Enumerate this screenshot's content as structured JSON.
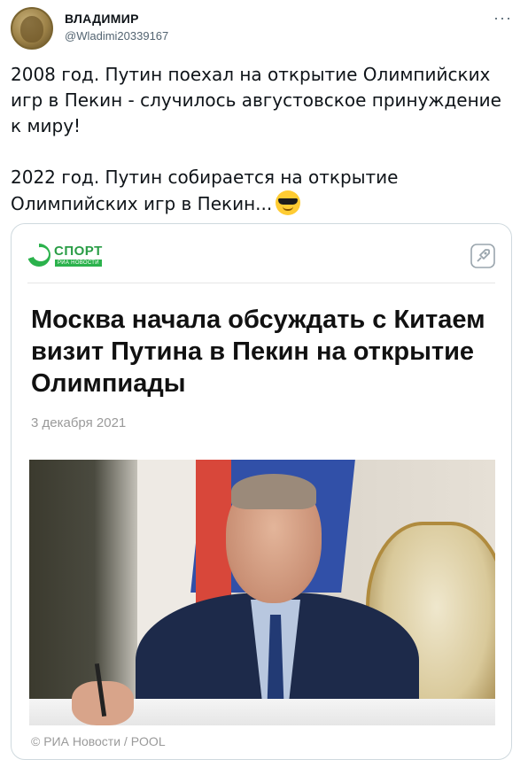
{
  "author": {
    "display_name": "ВЛАДИМИР",
    "handle": "@Wladimi20339167",
    "avatar_icon": "medal-portrait-avatar"
  },
  "more_label": "···",
  "tweet": {
    "line1": "2008 год. Путин поехал на открытие Олимпийских игр в Пекин - случилось августовское принуждение к миру!",
    "line2": "2022 год. Путин собирается на открытие Олимпийских игр в Пекин...",
    "emoji": "smiling-face-with-sunglasses"
  },
  "card": {
    "brand": "СПОРТ",
    "brand_sub": "РИА НОВОСТИ",
    "rocket_icon": "rocket-icon",
    "headline": "Москва начала обсуждать с Китаем визит Путина в Пекин на открытие Олимпиады",
    "date": "3 декабря 2021",
    "credit": "© РИА Новости / POOL",
    "colors": {
      "brand_green": "#2bb24c",
      "text_muted": "#9a9a9a"
    }
  }
}
